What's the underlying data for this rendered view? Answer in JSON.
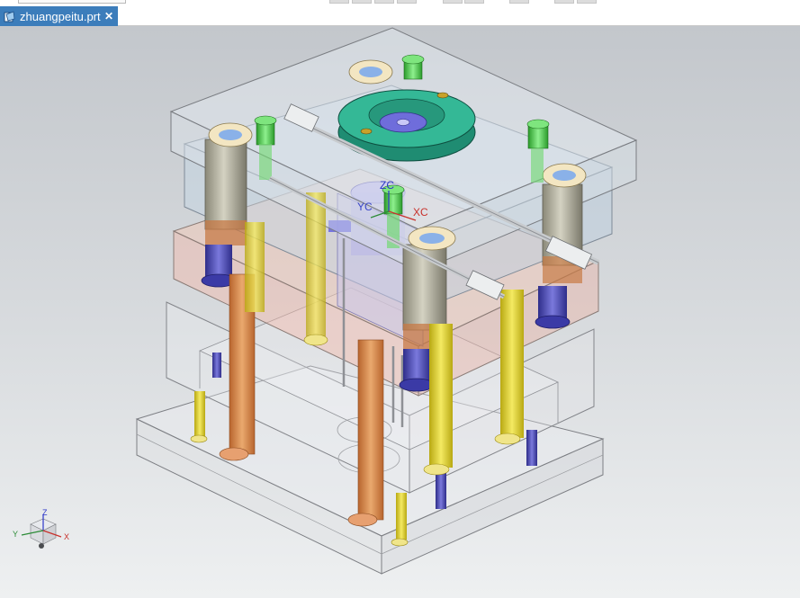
{
  "tab": {
    "title": "zhuangpeitu.prt",
    "close_glyph": "✕",
    "file_icon": "part-file-icon"
  },
  "view": {
    "wcs_labels": {
      "zc": "ZC",
      "yc": "YC",
      "xc": "XC"
    },
    "triad_labels": {
      "z": "Z",
      "y": "Y",
      "x": "X"
    }
  },
  "colors": {
    "tab_active": "#3c7dbb",
    "viewport_top": "#c3c7cc",
    "viewport_bottom": "#eef0f1",
    "locating_ring": "#2aa889",
    "green_bushing": "#3fc23f",
    "blue_pin": "#4a49b5",
    "orange_pin": "#d98b4a",
    "yellow_pin": "#dcd02a"
  }
}
